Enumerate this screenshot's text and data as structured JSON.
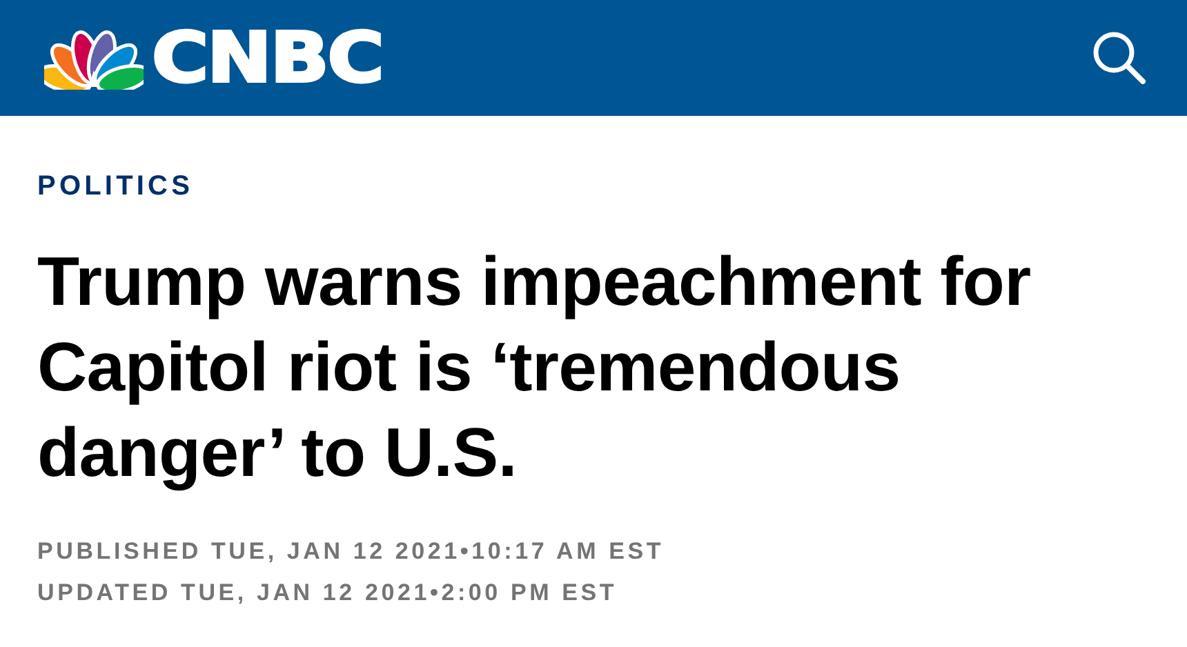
{
  "header": {
    "logo_text": "CNBC"
  },
  "category": "POLITICS",
  "headline": "Trump warns impeachment for Capitol riot is ‘tremendous danger’ to U.S.",
  "timestamps": [
    "PUBLISHED TUE, JAN 12 2021•10:17 AM EST",
    "UPDATED TUE, JAN 12 2021•2:00 PM EST"
  ]
}
